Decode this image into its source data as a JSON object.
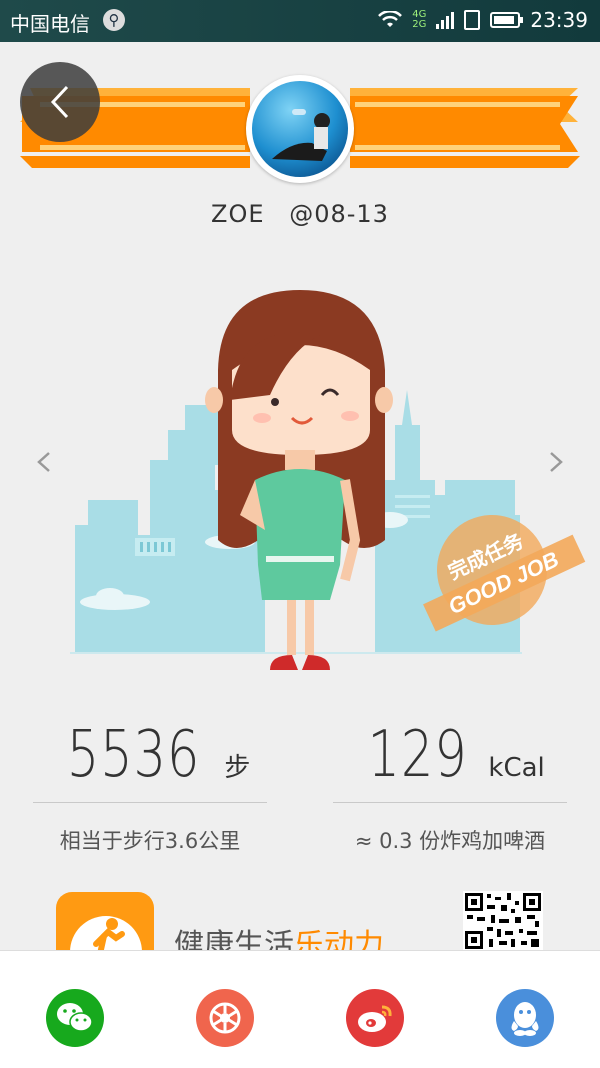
{
  "status_bar": {
    "carrier": "中国电信",
    "network_top": "4G",
    "network_bottom": "2G",
    "time": "23:39"
  },
  "profile": {
    "name": "ZOE",
    "date": "@08-13"
  },
  "stamp": {
    "text_cn": "完成任务",
    "text_en": "GOOD JOB"
  },
  "stats": {
    "steps": {
      "value": "5536",
      "unit": "步",
      "desc": "相当于步行3.6公里"
    },
    "calories": {
      "value": "129",
      "unit": "kCal",
      "desc": "≈ 0.3 份炸鸡加啤酒"
    }
  },
  "promo": {
    "text_plain": "健康生活",
    "text_accent": "乐动力"
  },
  "share": [
    "wechat-icon",
    "moments-icon",
    "weibo-icon",
    "qq-icon"
  ],
  "colors": {
    "ribbon": "#ff8a00",
    "ribbon_light": "#ffb23a",
    "accent": "#ff8a00",
    "wechat": "#17a91d",
    "moments": "#f0654d",
    "weibo": "#e23a3a",
    "qq": "#4a8fdb"
  }
}
